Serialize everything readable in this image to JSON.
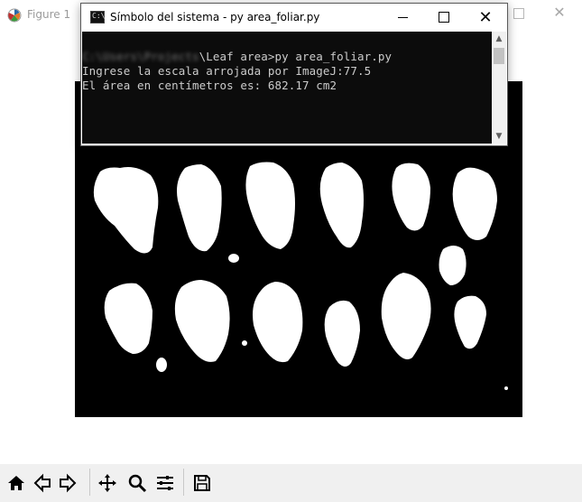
{
  "figure_window": {
    "title": "Figure 1",
    "toolbar_icons": [
      "home-icon",
      "back-icon",
      "forward-icon",
      "pan-icon",
      "zoom-icon",
      "configure-subplots-icon",
      "save-icon"
    ]
  },
  "console_window": {
    "title": "Símbolo del sistema - py  area_foliar.py",
    "icon_text": "C:\\",
    "lines": {
      "prompt_path_blurred": "C:\\Users\\Projects",
      "prompt_rest": "\\Leaf area>py area_foliar.py",
      "input_line": "Ingrese la escala arrojada por ImageJ:77.5",
      "result_line": "El área en centímetros es: 682.17 cm2"
    }
  },
  "colors": {
    "console_bg": "#0c0c0c",
    "console_text": "#cccccc",
    "canvas_bg": "#000000",
    "leaf": "#ffffff",
    "toolbar_bg": "#f0f0f0"
  }
}
